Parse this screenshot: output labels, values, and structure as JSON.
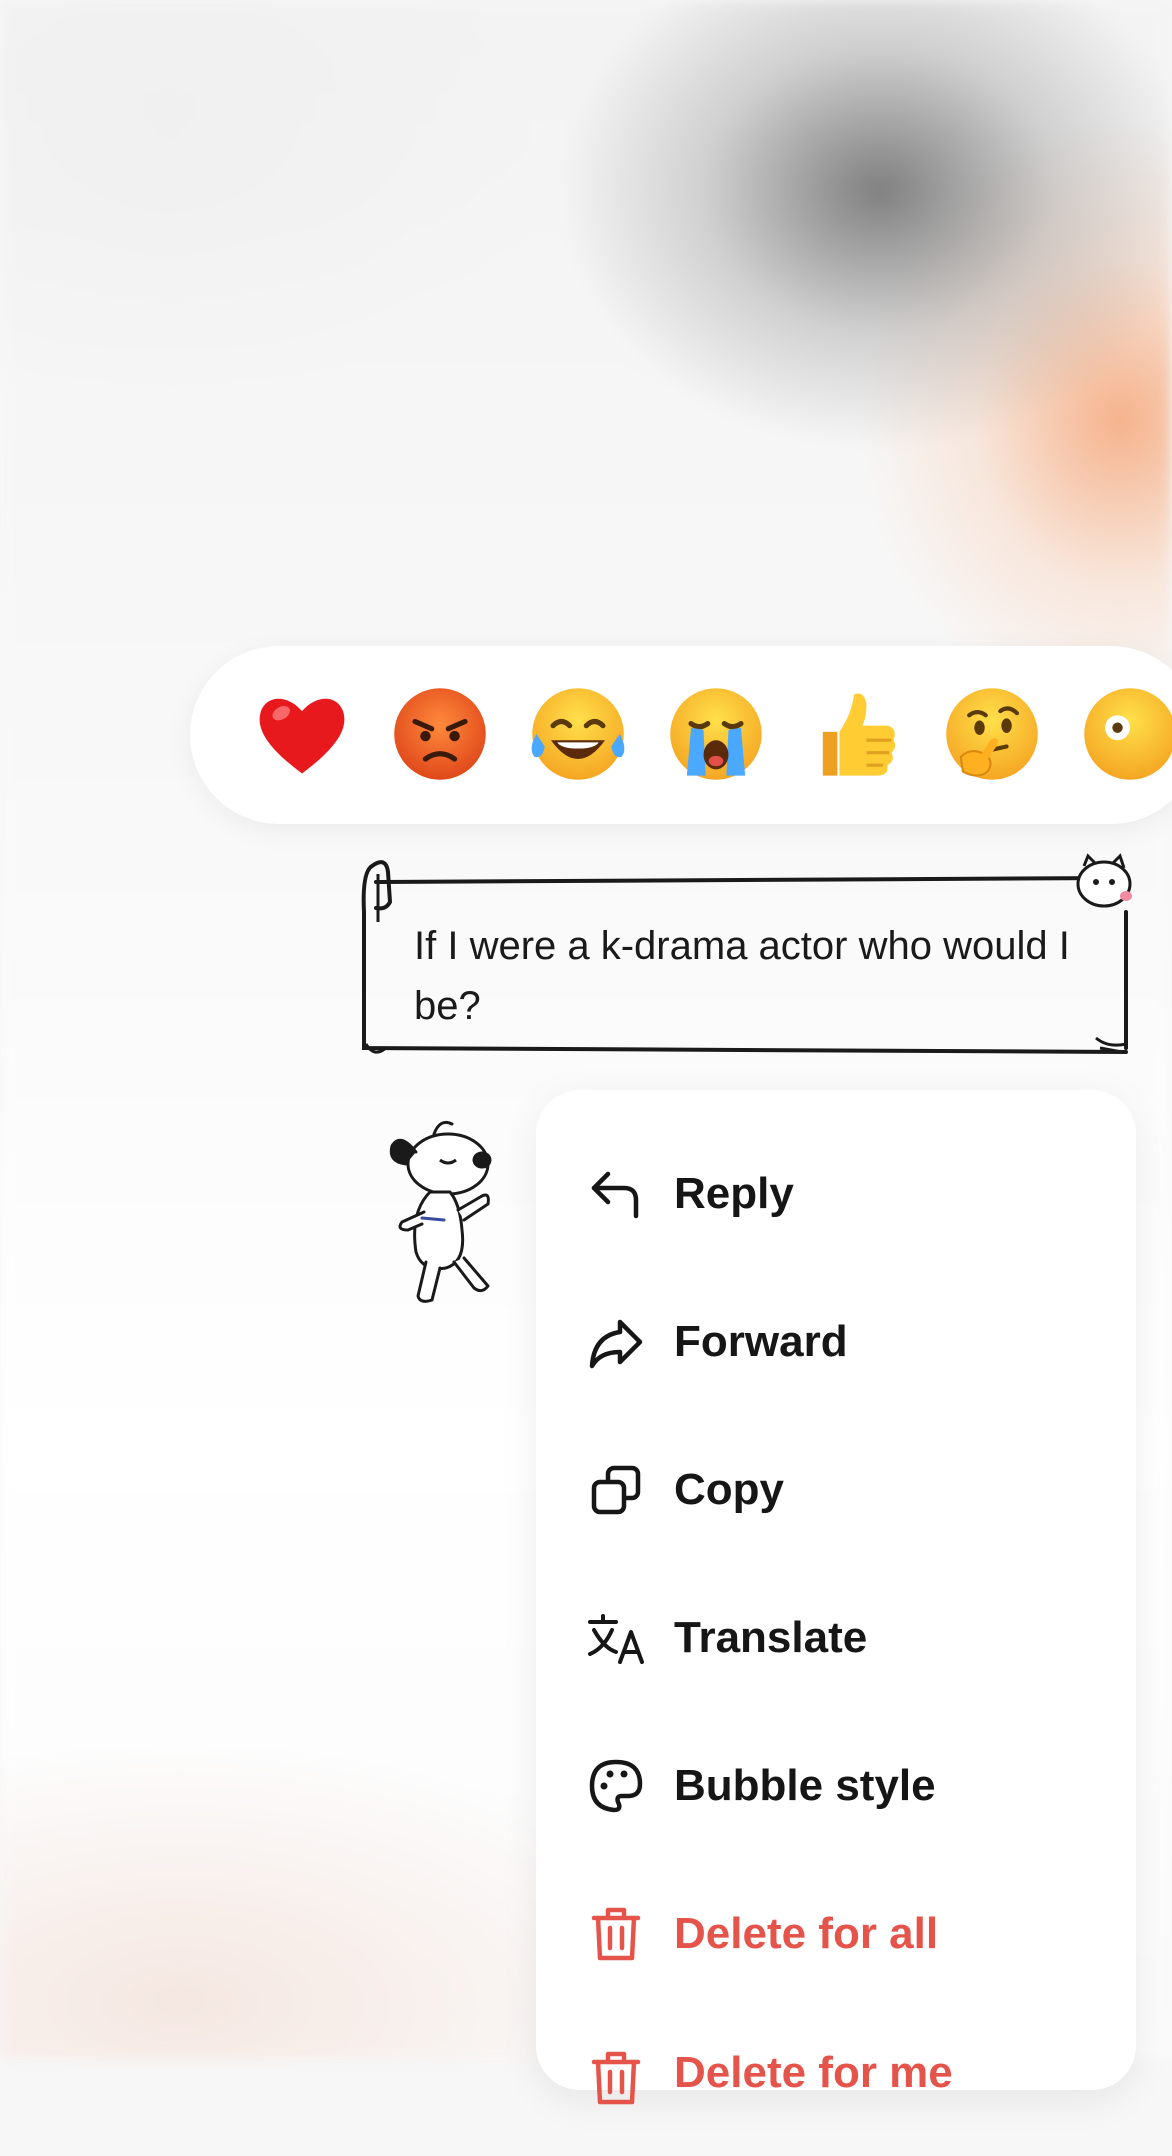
{
  "reactions": [
    {
      "icon": "red-heart-emoji"
    },
    {
      "icon": "angry-face-emoji"
    },
    {
      "icon": "tears-of-joy-emoji"
    },
    {
      "icon": "loudly-crying-emoji"
    },
    {
      "icon": "thumbs-up-emoji"
    },
    {
      "icon": "thinking-face-emoji"
    },
    {
      "icon": "face-emoji-partial"
    }
  ],
  "message": {
    "text": "If I were a k-drama actor who would I be?"
  },
  "sticker": {
    "icon": "dancing-dog-sticker"
  },
  "menu": {
    "items": [
      {
        "label": "Reply",
        "icon": "reply-arrow-icon"
      },
      {
        "label": "Forward",
        "icon": "forward-arrow-icon"
      },
      {
        "label": "Copy",
        "icon": "copy-icon"
      },
      {
        "label": "Translate",
        "icon": "translate-icon"
      },
      {
        "label": "Bubble style",
        "icon": "palette-icon"
      },
      {
        "label": "Delete for all",
        "icon": "trash-icon",
        "color": "#e5544b"
      },
      {
        "label": "Delete for me",
        "icon": "trash-icon",
        "color": "#e5544b"
      }
    ]
  },
  "colors": {
    "danger": "#e5544b",
    "text": "#161616",
    "menu_bg": "#ffffff"
  }
}
